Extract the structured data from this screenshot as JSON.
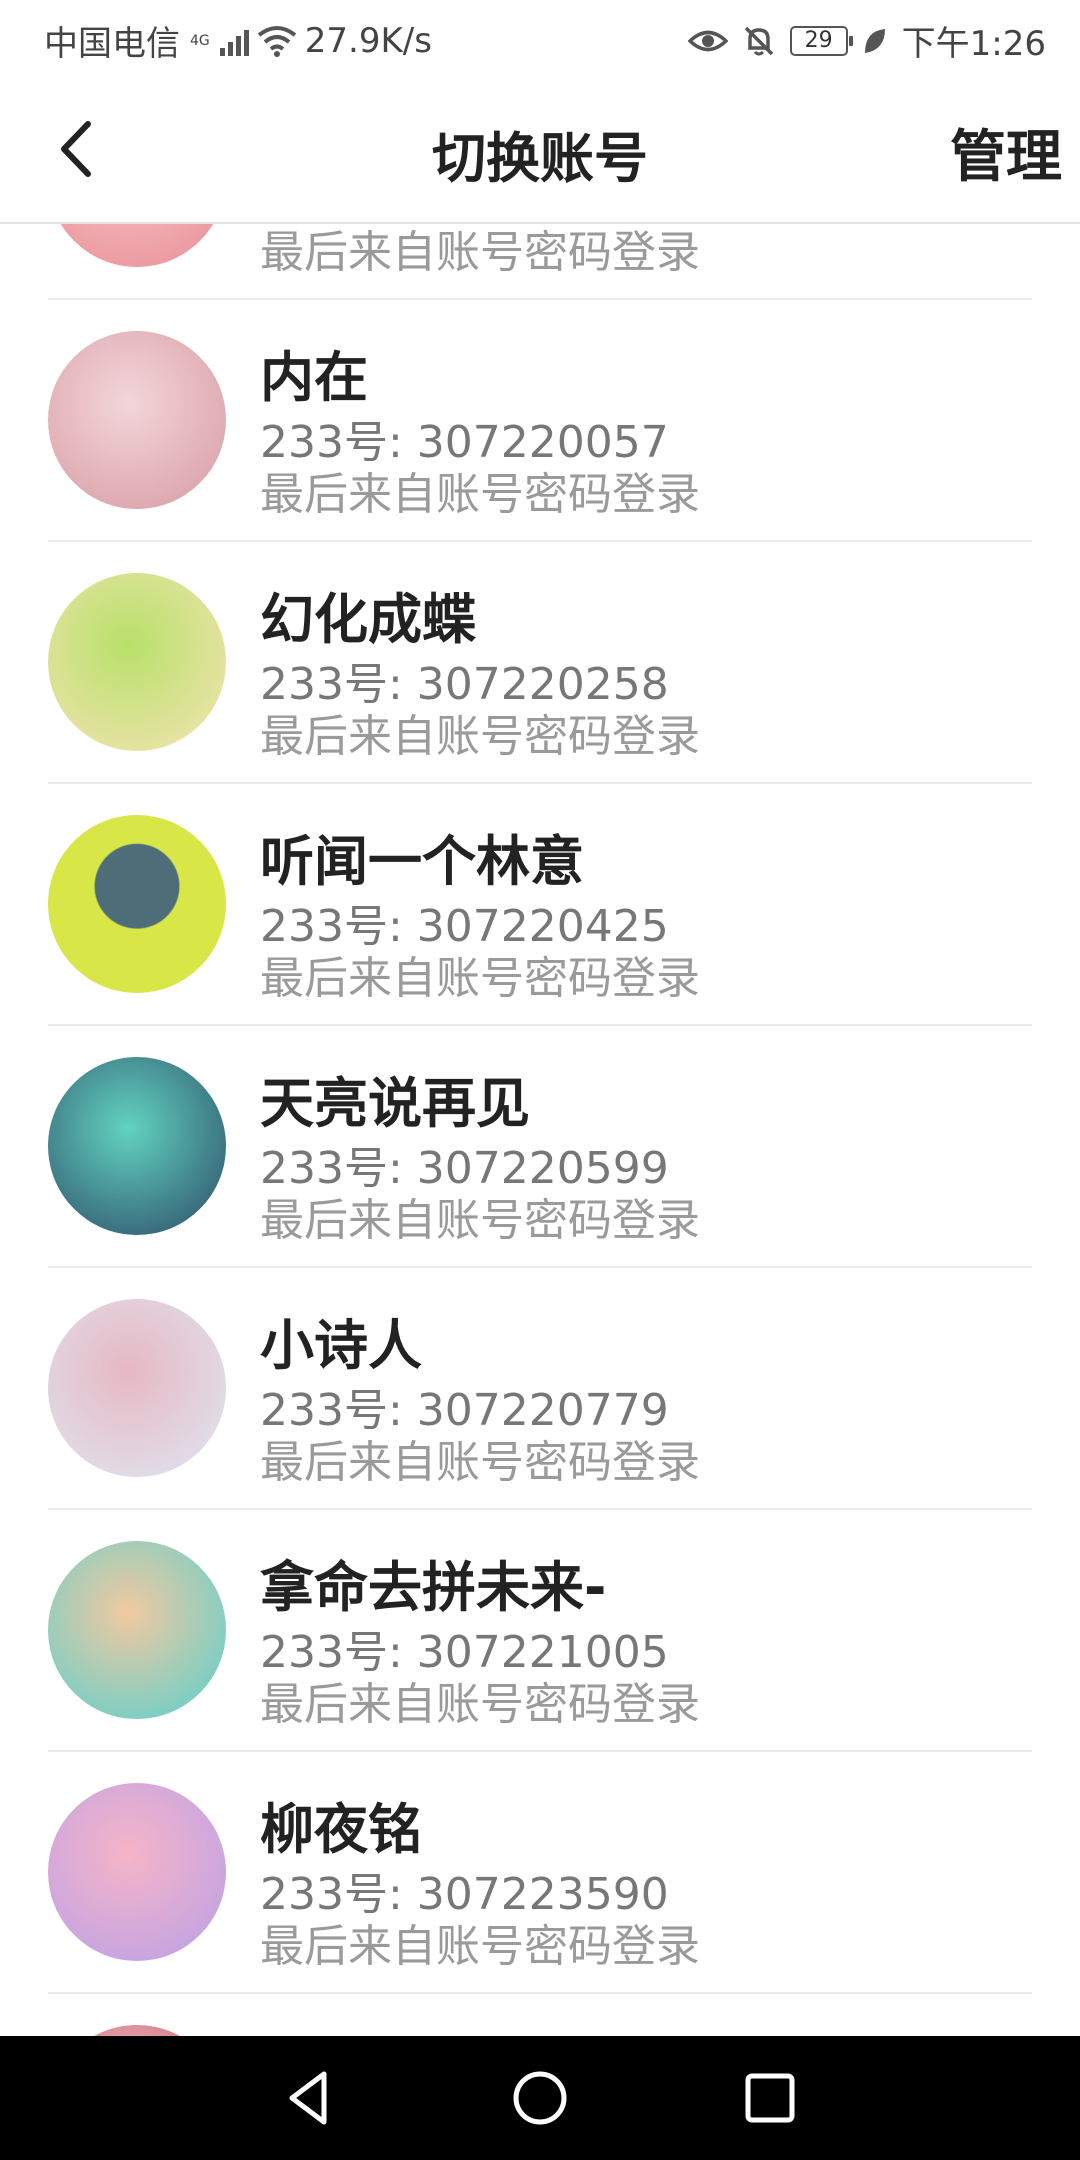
{
  "status_bar": {
    "carrier": "中国电信",
    "network": "4G",
    "speed": "27.9K/s",
    "battery": "29",
    "time": "下午1:26"
  },
  "header": {
    "title": "切换账号",
    "manage_label": "管理",
    "back_icon": "chevron-left-icon"
  },
  "accounts": [
    {
      "name": "",
      "id_line": "",
      "login_source": "最后来自账号密码登录",
      "avatar_colors": [
        "#f7c4c6",
        "#e98e96"
      ]
    },
    {
      "name": "内在",
      "id_line": "233号: 307220057",
      "login_source": "最后来自账号密码登录",
      "avatar_colors": [
        "#f3d6da",
        "#d79aa2"
      ]
    },
    {
      "name": "幻化成蝶",
      "id_line": "233号: 307220258",
      "login_source": "最后来自账号密码登录",
      "avatar_colors": [
        "#b8e06a",
        "#f5e4b5"
      ]
    },
    {
      "name": "听闻一个林意",
      "id_line": "233号: 307220425",
      "login_source": "最后来自账号密码登录",
      "avatar_colors": [
        "#d8e648",
        "#4d6d78"
      ]
    },
    {
      "name": "天亮说再见",
      "id_line": "233号: 307220599",
      "login_source": "最后来自账号密码登录",
      "avatar_colors": [
        "#62d3c0",
        "#2c4a66"
      ]
    },
    {
      "name": "小诗人",
      "id_line": "233号: 307220779",
      "login_source": "最后来自账号密码登录",
      "avatar_colors": [
        "#dfe7f3",
        "#e6b8c2"
      ]
    },
    {
      "name": "拿命去拼未来-",
      "id_line": "233号: 307221005",
      "login_source": "最后来自账号密码登录",
      "avatar_colors": [
        "#57d0cf",
        "#f2c9a0"
      ]
    },
    {
      "name": "柳夜铭",
      "id_line": "233号: 307223590",
      "login_source": "最后来自账号密码登录",
      "avatar_colors": [
        "#f6b4c8",
        "#b9a0e8"
      ]
    },
    {
      "name": "",
      "id_line": "",
      "login_source": "",
      "avatar_colors": [
        "#f4d2d6",
        "#c44a5a"
      ]
    }
  ],
  "nav_bar": {
    "back": "triangle-back-icon",
    "home": "circle-home-icon",
    "recents": "square-recents-icon"
  }
}
